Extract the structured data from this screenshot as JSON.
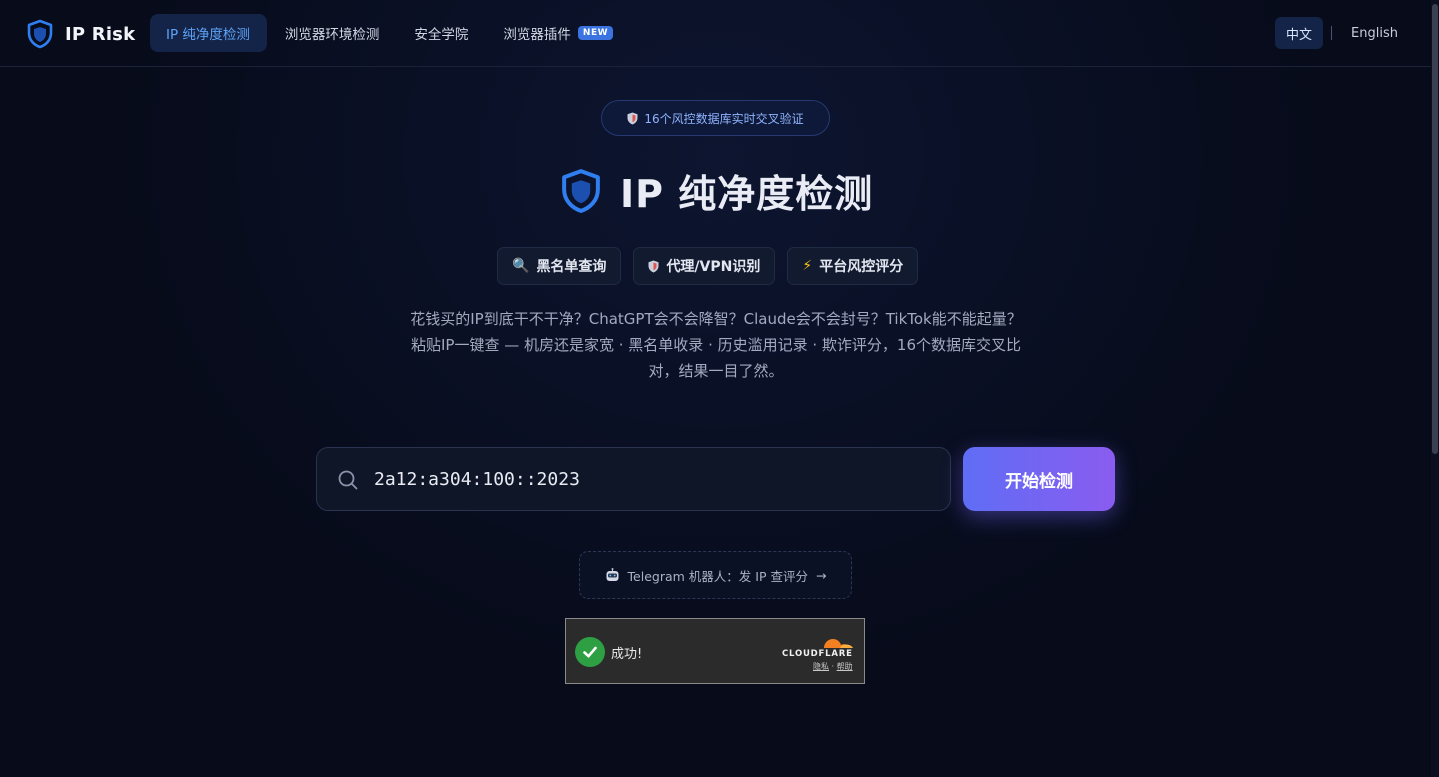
{
  "header": {
    "brand": "IP Risk",
    "nav": [
      {
        "label": "IP 纯净度检测",
        "active": true
      },
      {
        "label": "浏览器环境检测",
        "active": false
      },
      {
        "label": "安全学院",
        "active": false
      },
      {
        "label": "浏览器插件",
        "active": false,
        "badge": "NEW"
      }
    ],
    "lang": {
      "zh": "中文",
      "en": "English",
      "active": "zh"
    }
  },
  "hero": {
    "pill": "16个风控数据库实时交叉验证",
    "pill_icon": "shield-icon",
    "title": "IP 纯净度检测",
    "chips": [
      {
        "icon": "magnifier-icon",
        "glyph": "🔍",
        "label": "黑名单查询"
      },
      {
        "icon": "shield-icon",
        "glyph": "🛡",
        "label": "代理/VPN识别"
      },
      {
        "icon": "lightning-icon",
        "glyph": "⚡",
        "label": "平台风控评分"
      }
    ],
    "desc_line1": "花钱买的IP到底干不干净？ChatGPT会不会降智？Claude会不会封号？TikTok能不能起量？",
    "desc_line2": "粘贴IP一键查 — 机房还是家宽 · 黑名单收录 · 历史滥用记录 · 欺诈评分，16个数据库交叉比对，结果一目了然。"
  },
  "search": {
    "value": "2a12:a304:100::2023",
    "button": "开始检测"
  },
  "telegram": {
    "label": "Telegram 机器人：发 IP 查评分",
    "arrow": "→",
    "icon": "robot-icon"
  },
  "cloudflare": {
    "status": "成功!",
    "brand": "CLOUDFLARE",
    "privacy": "隐私",
    "sep": " · ",
    "help": "帮助"
  },
  "colors": {
    "background": "#070b1a",
    "accent": "#5da3f7",
    "button_start": "#5f6df5",
    "button_end": "#8a5cf0",
    "success": "#2ea043",
    "cloudflare_orange": "#f38020"
  }
}
